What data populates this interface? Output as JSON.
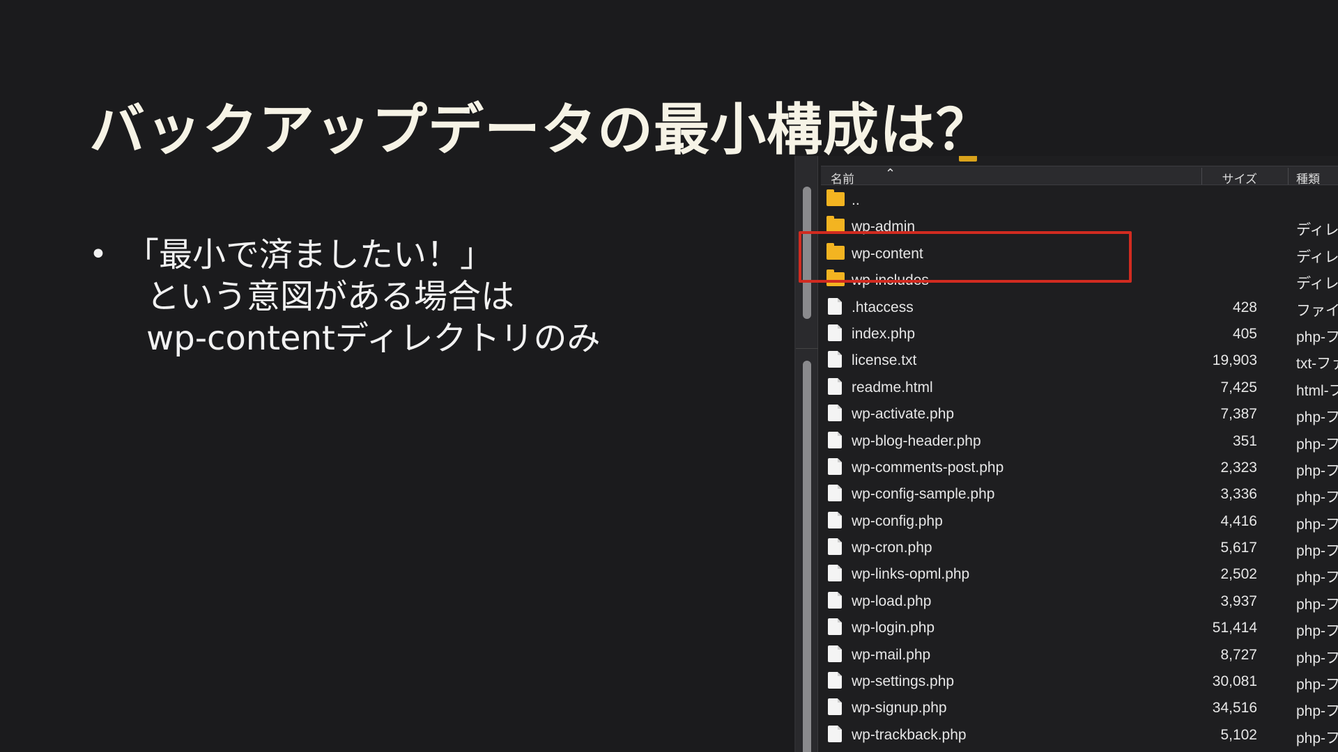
{
  "slide": {
    "title": "バックアップデータの最小構成は？",
    "bullet": {
      "marker": "•",
      "line1": "「最小で済ましたい！」",
      "line2": "という意図がある場合は",
      "line3": "wp-contentディレクトリのみ"
    }
  },
  "browser": {
    "columns": {
      "name": "名前",
      "size": "サイズ",
      "kind": "種類"
    },
    "highlight_color": "#d12b20",
    "rows": [
      {
        "icon": "folder-icon",
        "name": "..",
        "size": "",
        "kind": ""
      },
      {
        "icon": "folder-icon",
        "name": "wp-admin",
        "size": "",
        "kind": "ディレク"
      },
      {
        "icon": "folder-icon",
        "name": "wp-content",
        "size": "",
        "kind": "ディレク"
      },
      {
        "icon": "folder-icon",
        "name": "wp-includes",
        "size": "",
        "kind": "ディレク"
      },
      {
        "icon": "file-icon",
        "name": ".htaccess",
        "size": "428",
        "kind": "ファイル"
      },
      {
        "icon": "file-icon",
        "name": "index.php",
        "size": "405",
        "kind": "php-ファ"
      },
      {
        "icon": "file-icon",
        "name": "license.txt",
        "size": "19,903",
        "kind": "txt-ファ"
      },
      {
        "icon": "file-icon",
        "name": "readme.html",
        "size": "7,425",
        "kind": "html-フ"
      },
      {
        "icon": "file-icon",
        "name": "wp-activate.php",
        "size": "7,387",
        "kind": "php-ファ"
      },
      {
        "icon": "file-icon",
        "name": "wp-blog-header.php",
        "size": "351",
        "kind": "php-ファ"
      },
      {
        "icon": "file-icon",
        "name": "wp-comments-post.php",
        "size": "2,323",
        "kind": "php-ファ"
      },
      {
        "icon": "file-icon",
        "name": "wp-config-sample.php",
        "size": "3,336",
        "kind": "php-ファ"
      },
      {
        "icon": "file-icon",
        "name": "wp-config.php",
        "size": "4,416",
        "kind": "php-ファ"
      },
      {
        "icon": "file-icon",
        "name": "wp-cron.php",
        "size": "5,617",
        "kind": "php-ファ"
      },
      {
        "icon": "file-icon",
        "name": "wp-links-opml.php",
        "size": "2,502",
        "kind": "php-ファ"
      },
      {
        "icon": "file-icon",
        "name": "wp-load.php",
        "size": "3,937",
        "kind": "php-ファ"
      },
      {
        "icon": "file-icon",
        "name": "wp-login.php",
        "size": "51,414",
        "kind": "php-ファ"
      },
      {
        "icon": "file-icon",
        "name": "wp-mail.php",
        "size": "8,727",
        "kind": "php-ファ"
      },
      {
        "icon": "file-icon",
        "name": "wp-settings.php",
        "size": "30,081",
        "kind": "php-ファ"
      },
      {
        "icon": "file-icon",
        "name": "wp-signup.php",
        "size": "34,516",
        "kind": "php-ファ"
      },
      {
        "icon": "file-icon",
        "name": "wp-trackback.php",
        "size": "5,102",
        "kind": "php-ファ"
      }
    ]
  }
}
